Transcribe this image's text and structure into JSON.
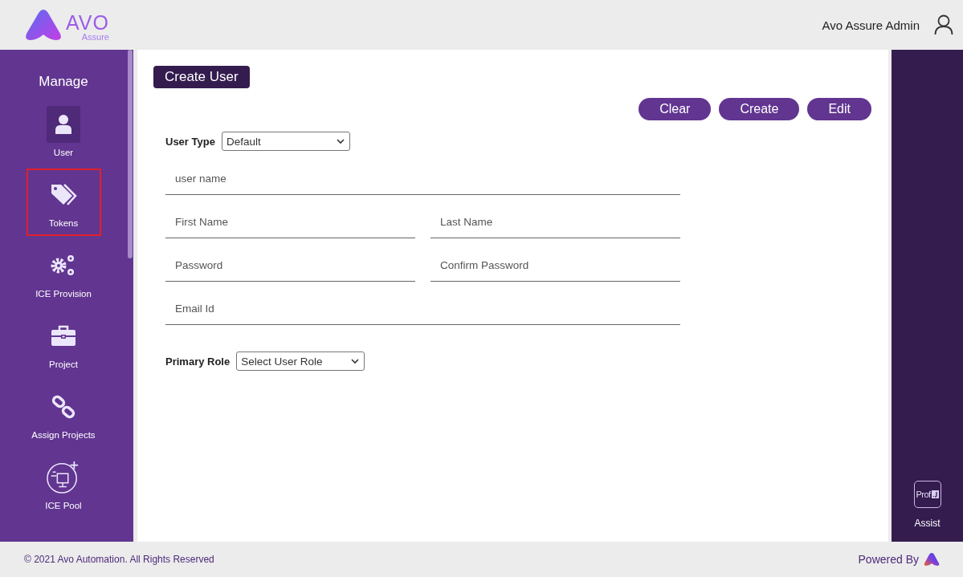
{
  "header": {
    "logo": {
      "title": "AVO",
      "subtitle": "Assure"
    },
    "user_name": "Avo Assure Admin"
  },
  "sidebar": {
    "title": "Manage",
    "items": [
      {
        "kind": "user",
        "label": "User",
        "selected": true,
        "highlighted": false
      },
      {
        "kind": "tags",
        "label": "Tokens",
        "selected": false,
        "highlighted": true
      },
      {
        "kind": "gears",
        "label": "ICE Provision",
        "selected": false,
        "highlighted": false
      },
      {
        "kind": "briefcase",
        "label": "Project",
        "selected": false,
        "highlighted": false
      },
      {
        "kind": "link",
        "label": "Assign Projects",
        "selected": false,
        "highlighted": false
      },
      {
        "kind": "monitor",
        "label": "ICE Pool",
        "selected": false,
        "highlighted": false
      }
    ]
  },
  "form": {
    "title": "Create User",
    "actions": [
      "Clear",
      "Create",
      "Edit"
    ],
    "user_type": {
      "label": "User Type",
      "value": "Default"
    },
    "field_rows": [
      [
        {
          "placeholder": "user name"
        }
      ],
      [
        {
          "placeholder": "First Name"
        },
        {
          "placeholder": "Last Name"
        }
      ],
      [
        {
          "placeholder": "Password"
        },
        {
          "placeholder": "Confirm Password"
        }
      ],
      [
        {
          "placeholder": "Email Id"
        }
      ]
    ],
    "primary_role": {
      "label": "Primary Role",
      "value": "Select User Role"
    }
  },
  "assist": {
    "icon_text": "Prof",
    "label": "Assist"
  },
  "footer": {
    "copyright": "© 2021 Avo Automation. All Rights Reserved",
    "powered_by": "Powered By"
  }
}
